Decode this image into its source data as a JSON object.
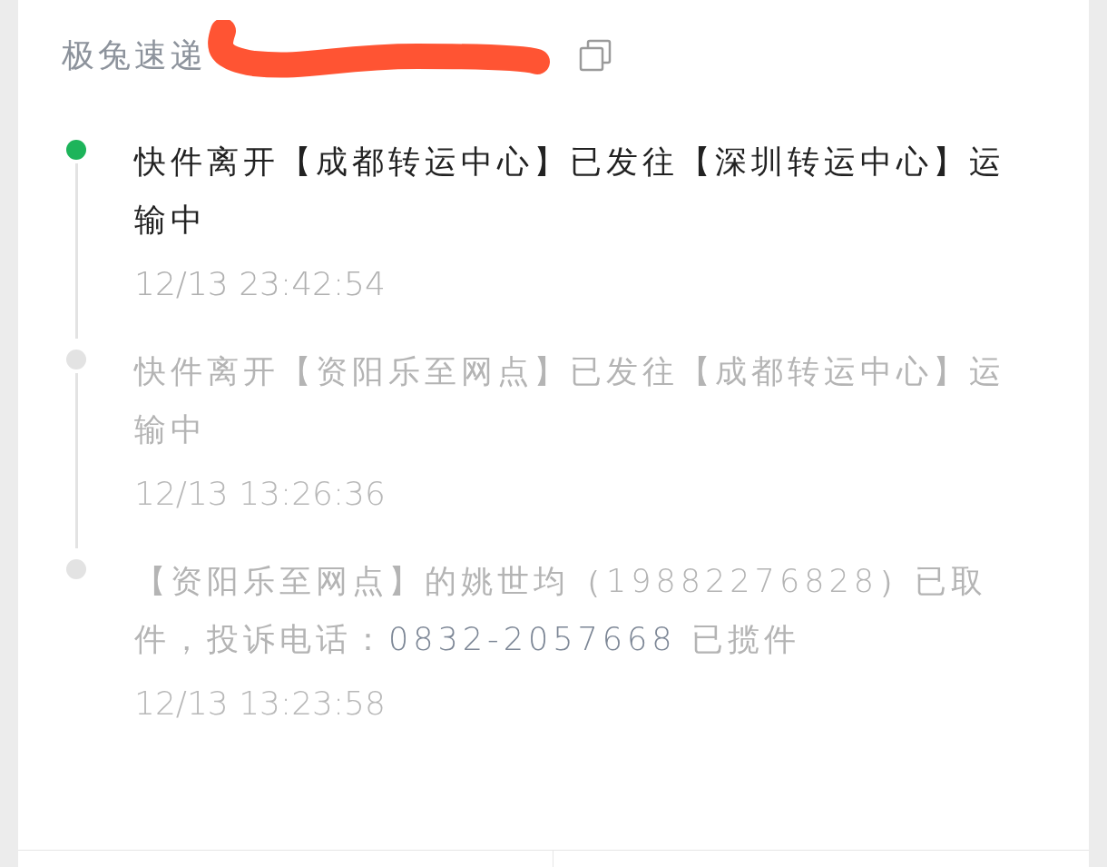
{
  "carrier": {
    "name": "极兔速递"
  },
  "events": [
    {
      "active": true,
      "segments": [
        {
          "kind": "text",
          "text": "快件离开【成都转运中心】已发往【深圳转运中心】运输中"
        }
      ],
      "time": "12/13 23:42:54"
    },
    {
      "active": false,
      "segments": [
        {
          "kind": "text",
          "text": "快件离开【资阳乐至网点】已发往【成都转运中心】运输中"
        }
      ],
      "time": "12/13 13:26:36"
    },
    {
      "active": false,
      "segments": [
        {
          "kind": "text",
          "text": "【资阳乐至网点】的姚世均（19882276828）已取件，投诉电话："
        },
        {
          "kind": "phone",
          "text": "0832-2057668"
        },
        {
          "kind": "text",
          "text": " 已揽件"
        }
      ],
      "time": "12/13 13:23:58"
    }
  ]
}
